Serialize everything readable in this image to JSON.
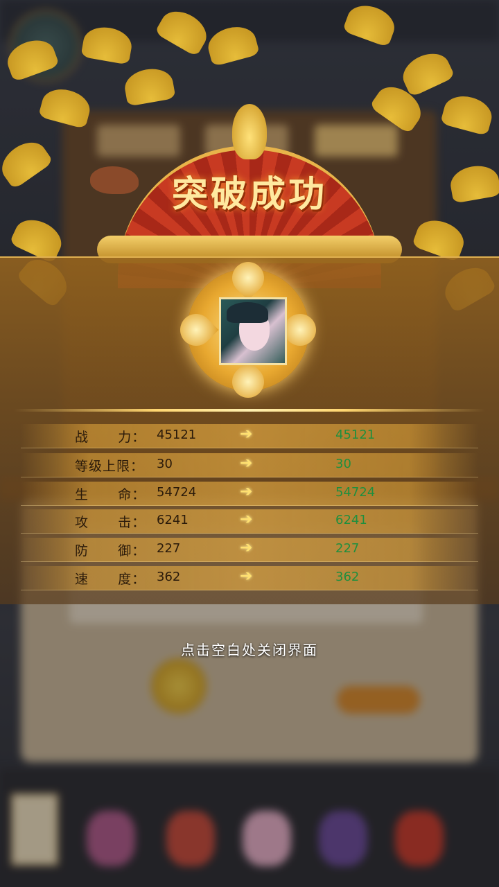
{
  "title": "突破成功",
  "stats": [
    {
      "label": "战      力：",
      "old": "45121",
      "new": "45121"
    },
    {
      "label": "等级上限：",
      "old": "30",
      "new": "30"
    },
    {
      "label": "生      命：",
      "old": "54724",
      "new": "54724"
    },
    {
      "label": "攻      击：",
      "old": "6241",
      "new": "6241"
    },
    {
      "label": "防      御：",
      "old": "227",
      "new": "227"
    },
    {
      "label": "速      度：",
      "old": "362",
      "new": "362"
    }
  ],
  "hint": "点击空白处关闭界面",
  "icons": {
    "arrow": "arrow-right-icon",
    "portrait": "hero-portrait"
  },
  "colors": {
    "new_value": "#1f8f3e",
    "title": "#ffe9a0",
    "panel": "#a0701e"
  }
}
